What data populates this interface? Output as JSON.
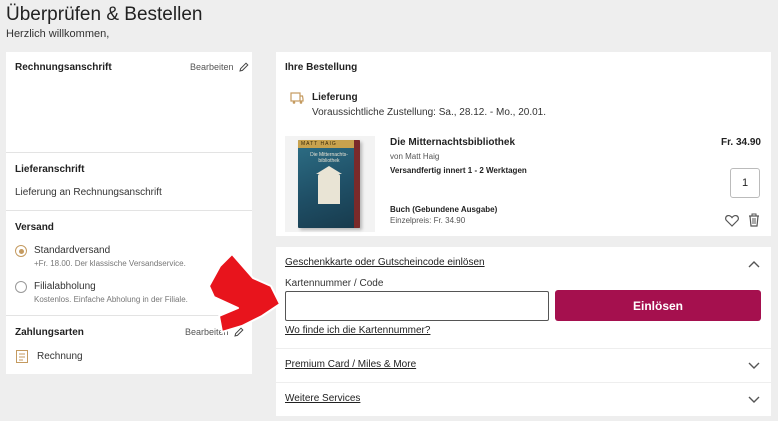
{
  "header": {
    "title": "Überprüfen & Bestellen",
    "welcome": "Herzlich willkommen,"
  },
  "billing": {
    "title": "Rechnungsanschrift",
    "edit_label": "Bearbeiten"
  },
  "shipping_address": {
    "title": "Lieferanschrift",
    "value": "Lieferung an Rechnungsanschrift"
  },
  "shipping": {
    "title": "Versand",
    "options": [
      {
        "label": "Standardversand",
        "desc": "+Fr. 18.00. Der klassische Versandservice.",
        "selected": true
      },
      {
        "label": "Filialabholung",
        "desc": "Kostenlos. Einfache Abholung in der Filiale.",
        "selected": false
      }
    ]
  },
  "payment": {
    "title": "Zahlungsarten",
    "edit_label": "Bearbeiten",
    "method": "Rechnung"
  },
  "order": {
    "title": "Ihre Bestellung",
    "delivery_label": "Lieferung",
    "delivery_date": "Voraussichtliche Zustellung: Sa., 28.12. - Mo., 20.01.",
    "item": {
      "title": "Die Mitternachtsbibliothek",
      "author": "von Matt Haig",
      "availability": "Versandfertig innert 1 - 2 Werktagen",
      "format": "Buch (Gebundene Ausgabe)",
      "unit_price": "Einzelpreis: Fr. 34.90",
      "price": "Fr. 34.90",
      "quantity": "1",
      "cover_author": "MATT HAIG",
      "cover_title": "Die Mitternachts-bibliothek"
    }
  },
  "gift": {
    "title": "Geschenkkarte oder Gutscheincode einlösen",
    "field_label": "Kartennummer / Code",
    "input_value": "",
    "button": "Einlösen",
    "help_link": "Wo finde ich die Kartennummer?"
  },
  "sections": {
    "premium": "Premium Card / Miles & More",
    "services": "Weitere Services"
  },
  "colors": {
    "accent": "#a5104e",
    "radio": "#c49a5f",
    "annotation_arrow": "#e8141c"
  }
}
